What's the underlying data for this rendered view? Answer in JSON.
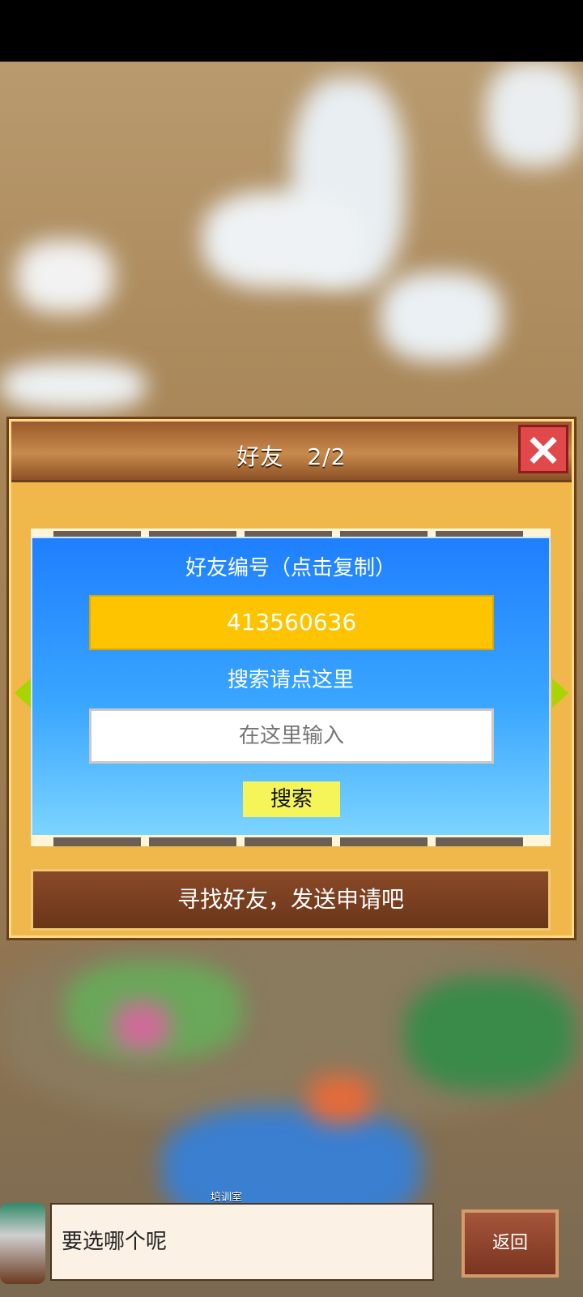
{
  "dialog": {
    "title": "好友　2/2",
    "friend_id_label": "好友编号（点击复制）",
    "friend_id": "413560636",
    "search_prompt": "搜索请点这里",
    "search_placeholder": "在这里输入",
    "search_button": "搜索",
    "footer_message": "寻找好友，发送申请吧"
  },
  "bottom": {
    "room_label": "培训室",
    "speech": "要选哪个呢",
    "return_button": "返回"
  },
  "icons": {
    "close": "close-icon",
    "left_arrow": "arrow-left-icon",
    "right_arrow": "arrow-right-icon"
  },
  "colors": {
    "id_box": "#ffc400",
    "search_button": "#f5f55a",
    "close_button": "#e0484a",
    "arrow": "#a9d400"
  }
}
